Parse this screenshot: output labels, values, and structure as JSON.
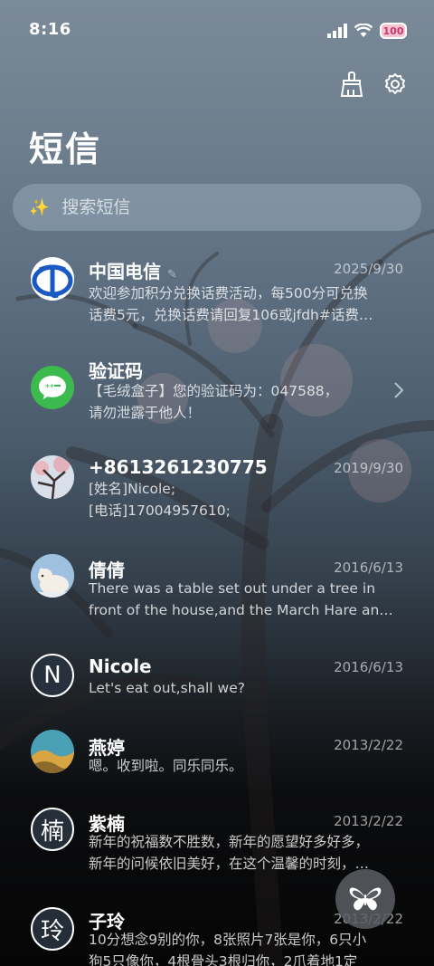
{
  "status": {
    "time": "8:16",
    "battery": "100"
  },
  "header": {
    "title": "短信"
  },
  "search": {
    "placeholder": "搜索短信"
  },
  "messages": [
    {
      "name": "中国电信",
      "date": "2025/9/30",
      "line1": "欢迎参加积分兑换话费活动，每500分可兑换",
      "line2": "话费5元，兑换话费请回复106或jfdh#话费…",
      "avatar": "china-telecom-logo"
    },
    {
      "name": "验证码",
      "date": "",
      "line1": "【毛绒盒子】您的验证码为：047588，",
      "line2": "请勿泄露于他人！",
      "avatar": "sms-code-icon"
    },
    {
      "name": "+8613261230775",
      "date": "2019/9/30",
      "line1": "[姓名]Nicole;",
      "line2": "[电话]17004957610;",
      "avatar": "tree-photo"
    },
    {
      "name": "倩倩",
      "date": "2016/6/13",
      "line1": "There was a table set out under a tree in",
      "line2": "front of the house,and the March Hare an…",
      "avatar": "polar-bear-photo"
    },
    {
      "name": "Nicole",
      "date": "2016/6/13",
      "line1": "Let's eat out,shall we?",
      "line2": "",
      "avatar": "N"
    },
    {
      "name": "燕婷",
      "date": "2013/2/22",
      "line1": "嗯。收到啦。同乐同乐。",
      "line2": "",
      "avatar": "landscape-photo"
    },
    {
      "name": "紫楠",
      "date": "2013/2/22",
      "line1": "新年的祝福数不胜数，新年的愿望好多好多，",
      "line2": "新年的问候依旧美好，在这个温馨的时刻，…",
      "avatar": "楠"
    },
    {
      "name": "子玲",
      "date": "2013/2/22",
      "line1": "10分想念9别的你，8张照片7张是你，6只小",
      "line2": "狗5只像你，4根骨头3根归你，2爪着地1定",
      "avatar": "玲"
    }
  ]
}
